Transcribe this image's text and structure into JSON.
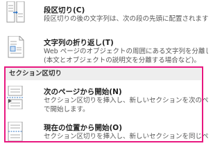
{
  "menu": {
    "column_break": {
      "title": "段区切り(C)",
      "desc_lines": [
        "段区切りの後の文字列は、次の段の先頭に配置されます"
      ]
    },
    "text_wrapping": {
      "title": "文字列の折り返し(T)",
      "desc_lines": [
        "Web ページのオブジェクトの周囲にある文字列を分離します",
        "(本文とオブジェクトの説明文を分離する場合など)。"
      ]
    },
    "section_header": "セクション区切り",
    "next_page": {
      "title": "次のページから開始(N)",
      "desc_lines": [
        "セクション区切りを挿入し、新しいセクションを次のページ",
        "で開始します。"
      ]
    },
    "continuous": {
      "title": "現在の位置から開始(O)",
      "desc_lines": [
        "セクション区切りを挿入し、新しいセクションを同じページ"
      ]
    }
  },
  "colors": {
    "highlight": "#e8177f",
    "accent_arrow": "#2e75c6"
  }
}
